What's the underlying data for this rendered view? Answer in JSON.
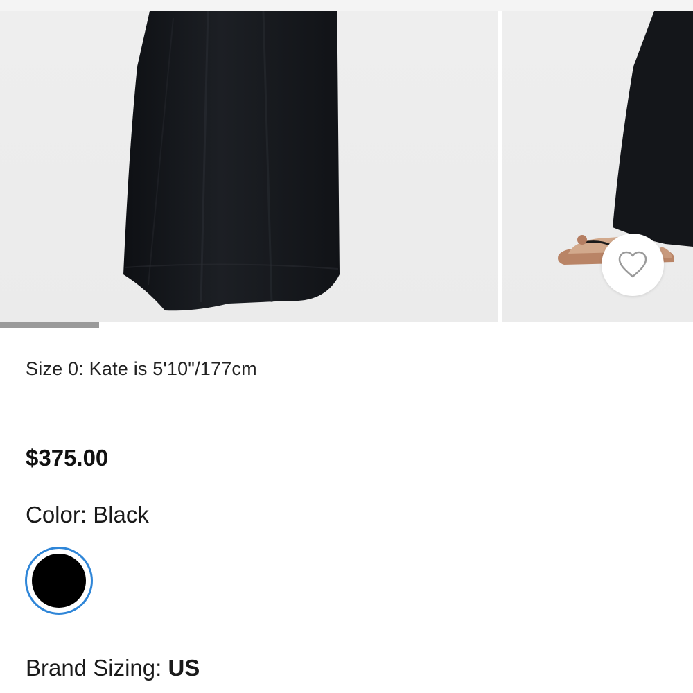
{
  "gallery": {
    "images": [
      {
        "icon": "product-photo-skirt-front"
      },
      {
        "icon": "product-photo-skirt-side-sandals"
      }
    ],
    "progress": 0.143
  },
  "favorite": {
    "icon": "heart-outline-icon"
  },
  "product": {
    "size_note": "Size 0: Kate is 5'10\"/177cm",
    "price": "$375.00",
    "color_label": "Color: ",
    "color_value": "Black",
    "swatches": [
      {
        "name": "Black",
        "hex": "#000000",
        "selected": true
      }
    ],
    "sizing_label": "Brand Sizing: ",
    "sizing_value": "US"
  },
  "colors": {
    "selected_ring": "#2f86d8",
    "progress_fill": "#9a9a9a",
    "garment": "#16181c"
  }
}
